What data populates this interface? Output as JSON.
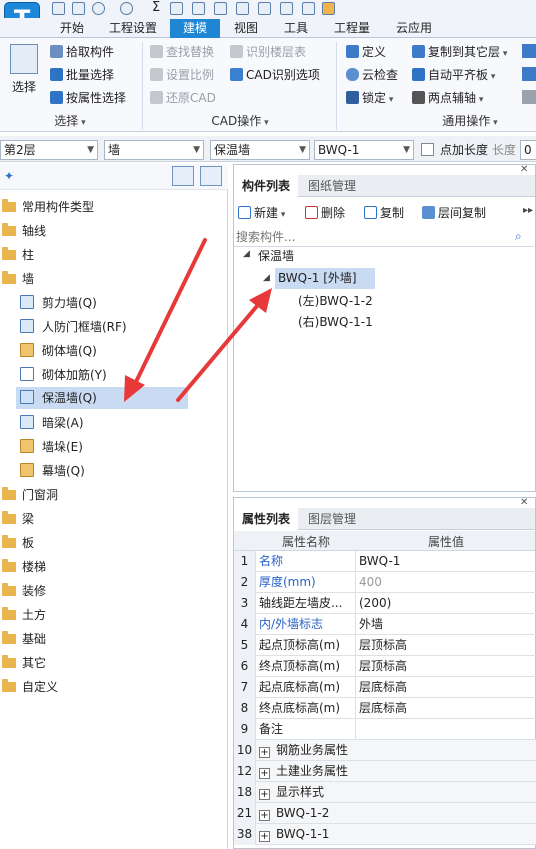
{
  "ribbon_tabs": [
    "开始",
    "工程设置",
    "建模",
    "视图",
    "工具",
    "工程量",
    "云应用"
  ],
  "active_tab": "建模",
  "ribbon": {
    "select_label": "选择",
    "group_select": {
      "items": [
        "拾取构件",
        "批量选择",
        "按属性选择"
      ],
      "label": "选择"
    },
    "group_cad": {
      "items": [
        "查找替换",
        "识别楼层表",
        "设置比例",
        "CAD识别选项",
        "还原CAD"
      ],
      "label": "CAD操作"
    },
    "group_common": {
      "items": [
        "定义",
        "复制到其它层",
        "云检查",
        "自动平齐板",
        "锁定",
        "两点辅轴"
      ],
      "label": "通用操作"
    }
  },
  "selectors": {
    "floor": "第2层",
    "type": "墙",
    "subtype": "保温墙",
    "instance": "BWQ-1",
    "point_length_label": "点加长度",
    "length_label": "长度",
    "length_value": "0"
  },
  "tree": [
    {
      "label": "常用构件类型",
      "kind": "folder"
    },
    {
      "label": "轴线",
      "kind": "folder"
    },
    {
      "label": "柱",
      "kind": "folder"
    },
    {
      "label": "墙",
      "kind": "folder"
    },
    {
      "label": "剪力墙(Q)",
      "kind": "child"
    },
    {
      "label": "人防门框墙(RF)",
      "kind": "child"
    },
    {
      "label": "砌体墙(Q)",
      "kind": "child"
    },
    {
      "label": "砌体加筋(Y)",
      "kind": "child"
    },
    {
      "label": "保温墙(Q)",
      "kind": "child",
      "selected": true
    },
    {
      "label": "暗梁(A)",
      "kind": "child"
    },
    {
      "label": "墙垛(E)",
      "kind": "child"
    },
    {
      "label": "幕墙(Q)",
      "kind": "child"
    },
    {
      "label": "门窗洞",
      "kind": "folder"
    },
    {
      "label": "梁",
      "kind": "folder"
    },
    {
      "label": "板",
      "kind": "folder"
    },
    {
      "label": "楼梯",
      "kind": "folder"
    },
    {
      "label": "装修",
      "kind": "folder"
    },
    {
      "label": "土方",
      "kind": "folder"
    },
    {
      "label": "基础",
      "kind": "folder"
    },
    {
      "label": "其它",
      "kind": "folder"
    },
    {
      "label": "自定义",
      "kind": "folder"
    }
  ],
  "component_panel": {
    "tabs": [
      "构件列表",
      "图纸管理"
    ],
    "toolbar": [
      "新建",
      "删除",
      "复制",
      "层间复制"
    ],
    "search_placeholder": "搜索构件...",
    "root": "保温墙",
    "selected": "BWQ-1 [外墙]",
    "children": [
      "(左)BWQ-1-2",
      "(右)BWQ-1-1"
    ]
  },
  "property_panel": {
    "tabs": [
      "属性列表",
      "图层管理"
    ],
    "columns": [
      "属性名称",
      "属性值"
    ],
    "rows": [
      {
        "num": "1",
        "name": "名称",
        "value": "BWQ-1",
        "name_style": "blue"
      },
      {
        "num": "2",
        "name": "厚度(mm)",
        "value": "400",
        "name_style": "blue",
        "value_style": "grey"
      },
      {
        "num": "3",
        "name": "轴线距左墙皮...",
        "value": "(200)"
      },
      {
        "num": "4",
        "name": "内/外墙标志",
        "value": "外墙",
        "name_style": "blue"
      },
      {
        "num": "5",
        "name": "起点顶标高(m)",
        "value": "层顶标高"
      },
      {
        "num": "6",
        "name": "终点顶标高(m)",
        "value": "层顶标高"
      },
      {
        "num": "7",
        "name": "起点底标高(m)",
        "value": "层底标高"
      },
      {
        "num": "8",
        "name": "终点底标高(m)",
        "value": "层底标高"
      },
      {
        "num": "9",
        "name": "备注",
        "value": ""
      },
      {
        "num": "10",
        "name": "钢筋业务属性",
        "value": "",
        "group": true
      },
      {
        "num": "12",
        "name": "土建业务属性",
        "value": "",
        "group": true
      },
      {
        "num": "18",
        "name": "显示样式",
        "value": "",
        "group": true
      },
      {
        "num": "21",
        "name": "BWQ-1-2",
        "value": "",
        "group": true
      },
      {
        "num": "38",
        "name": "BWQ-1-1",
        "value": "",
        "group": true
      }
    ]
  },
  "colors": {
    "accent": "#1f86d4",
    "selection": "#c9dbf2",
    "arrow": "#e8393a",
    "property_blue": "#2a63c6"
  }
}
